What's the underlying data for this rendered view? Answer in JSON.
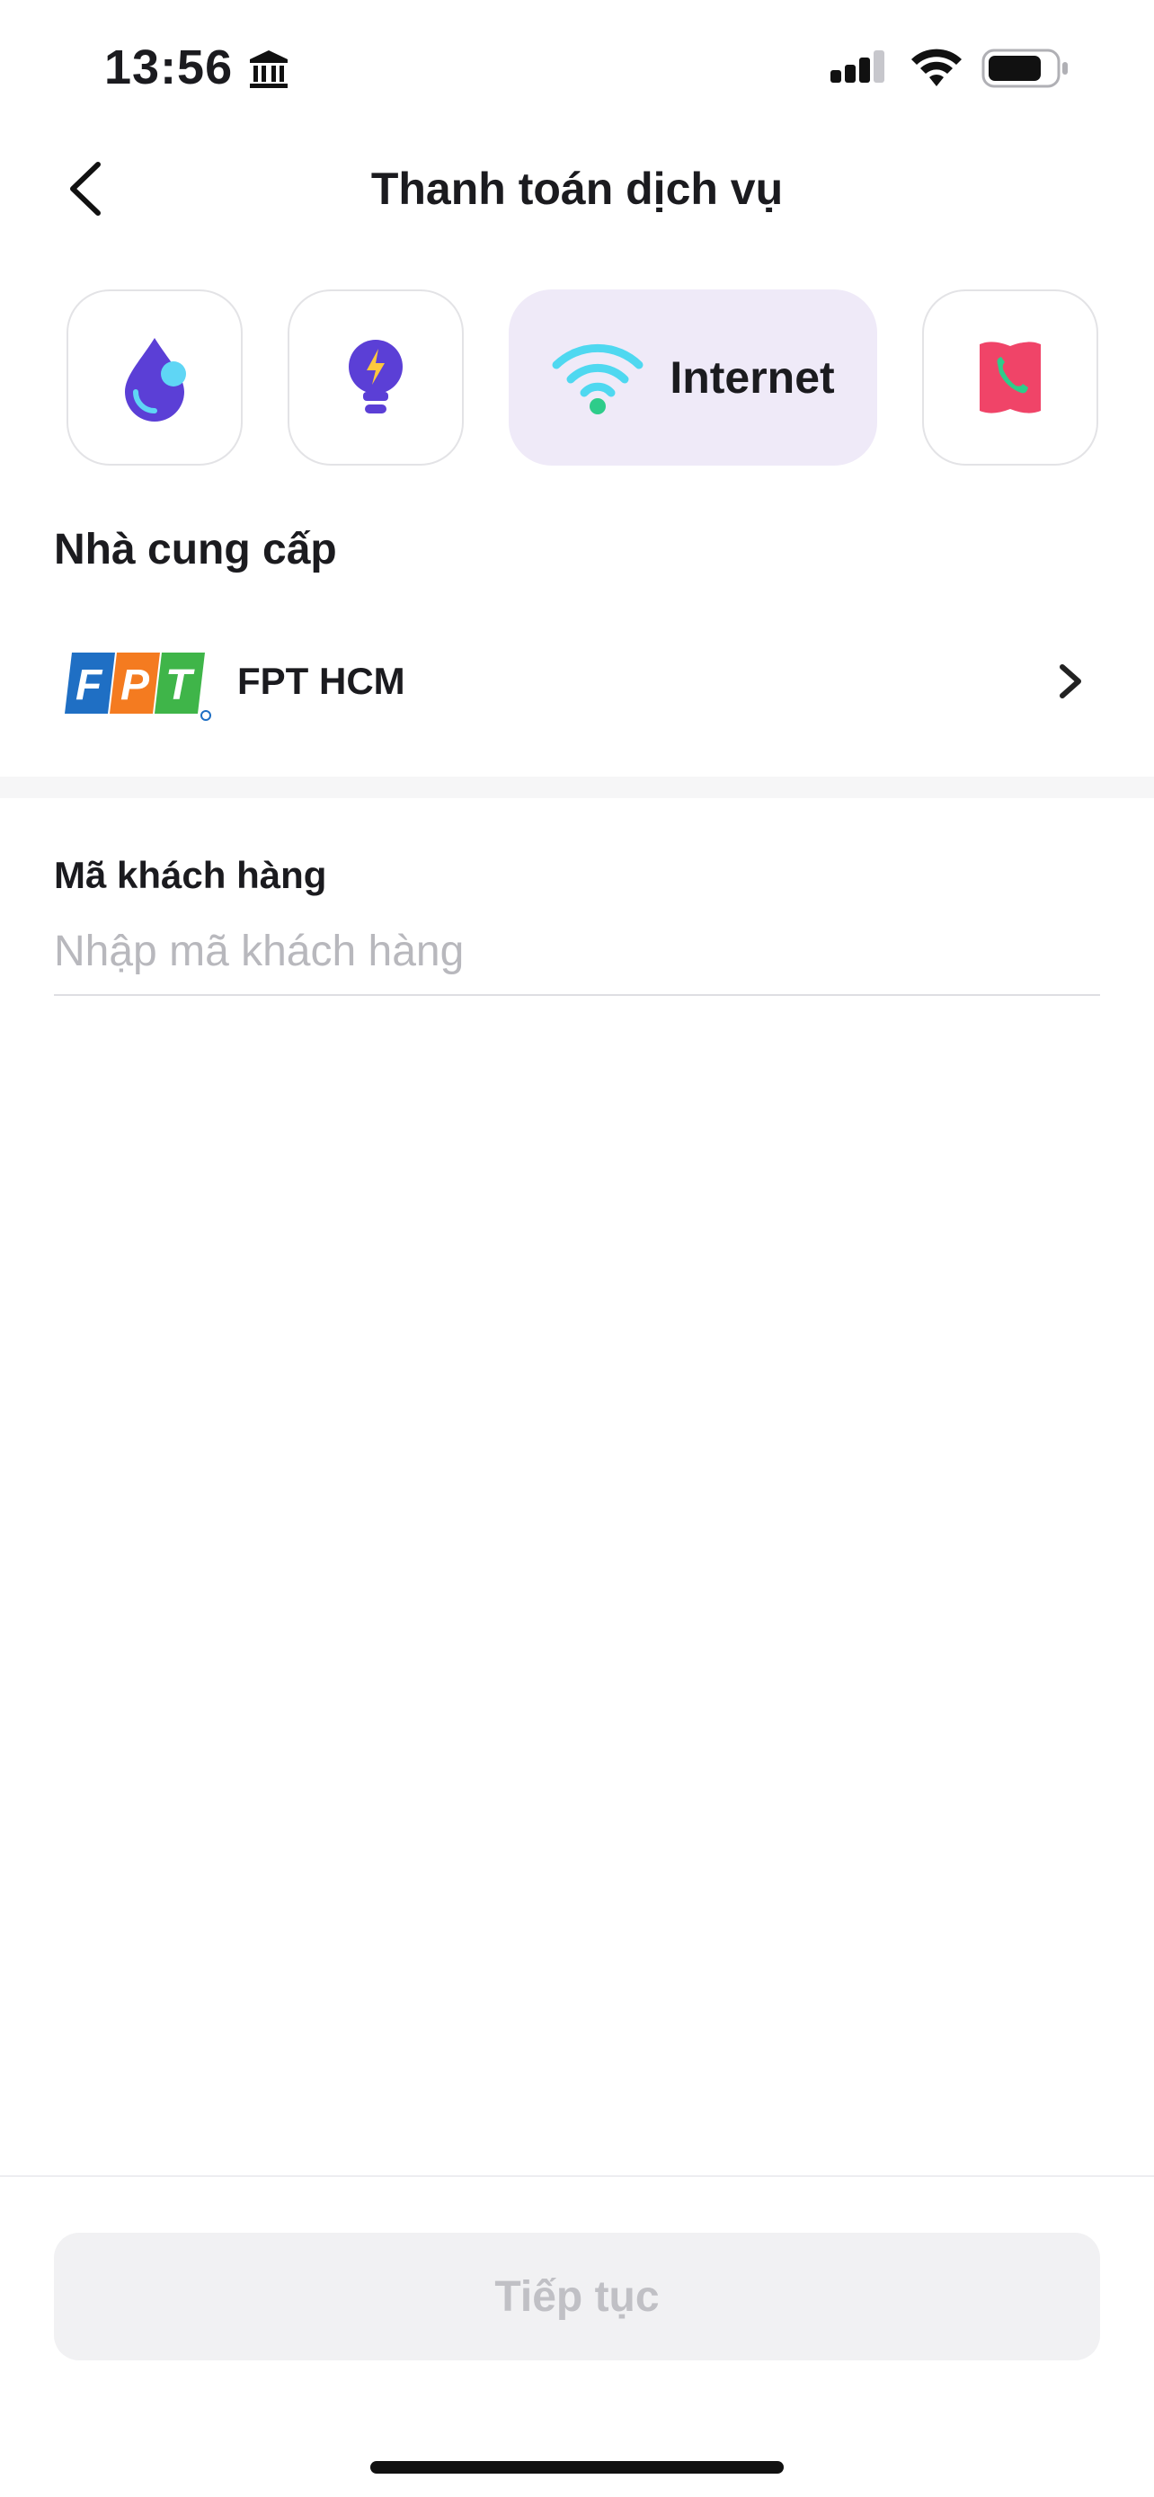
{
  "status_bar": {
    "time": "13:56",
    "icons": [
      "bank-icon",
      "signal-icon",
      "wifi-icon",
      "battery-icon"
    ]
  },
  "header": {
    "title": "Thanh toán dịch vụ",
    "back_icon": "chevron-left-icon"
  },
  "service_tabs": [
    {
      "id": "water",
      "icon": "water-drop-icon",
      "label": "",
      "active": false
    },
    {
      "id": "electricity",
      "icon": "lightbulb-icon",
      "label": "",
      "active": false
    },
    {
      "id": "internet",
      "icon": "wifi-icon",
      "label": "Internet",
      "active": true
    },
    {
      "id": "phone",
      "icon": "phone-icon",
      "label": "",
      "active": false
    }
  ],
  "provider": {
    "section_title": "Nhà cung cấp",
    "name": "FPT HCM",
    "logo_icon": "fpt-logo"
  },
  "customer_code": {
    "label": "Mã khách hàng",
    "placeholder": "Nhập mã khách hàng",
    "value": ""
  },
  "actions": {
    "continue_label": "Tiếp tục",
    "continue_enabled": false
  },
  "colors": {
    "accent_purple": "#5b3fd6",
    "active_tab_bg": "#efeaf8",
    "wifi_cyan": "#4fd8f0",
    "phone_red": "#f04468",
    "disabled_button_bg": "#f1f1f3",
    "disabled_button_text": "#c0c0c5"
  }
}
